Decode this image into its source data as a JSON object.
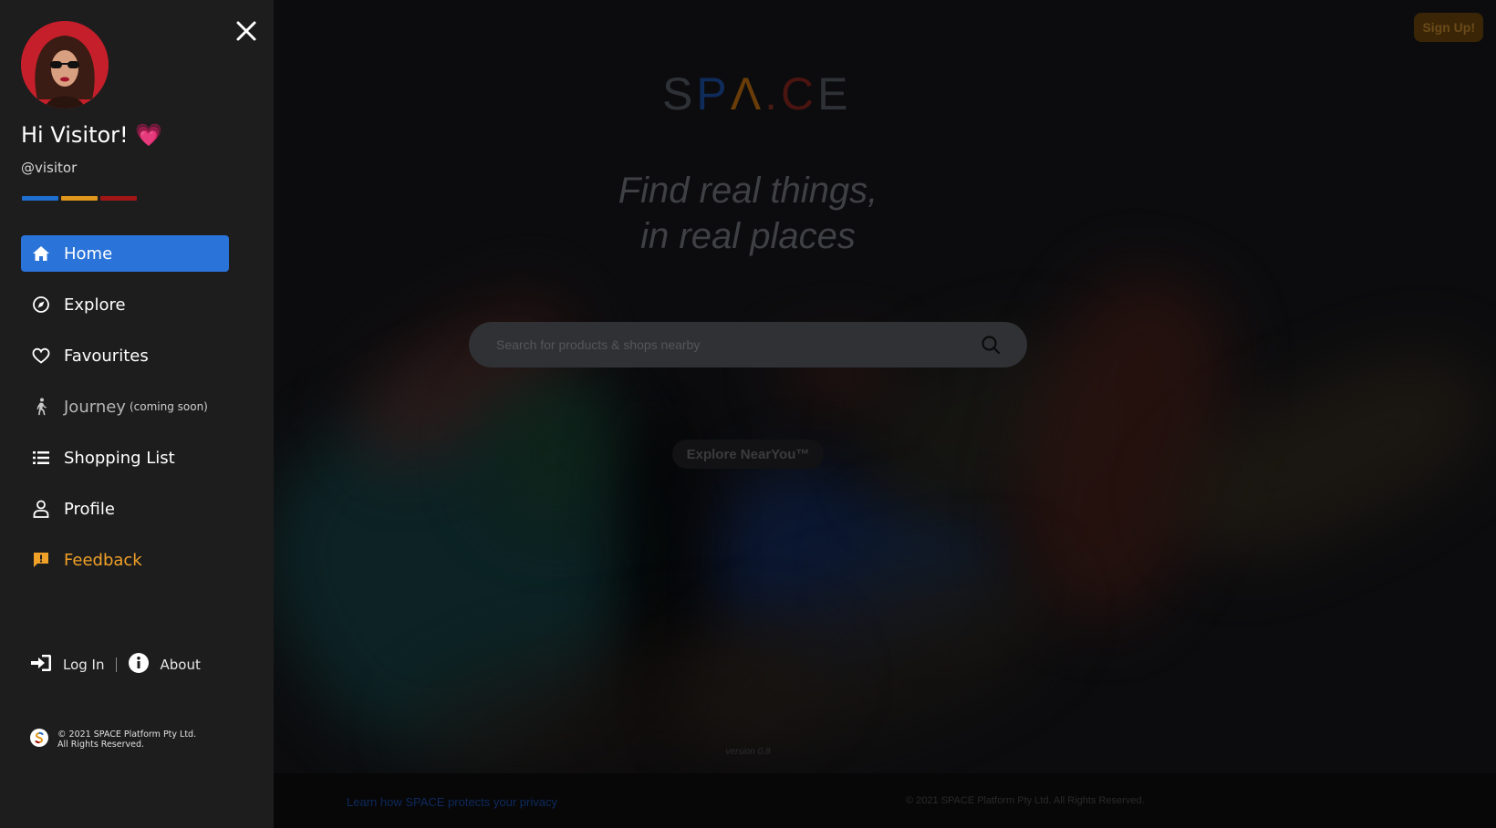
{
  "sidebar": {
    "greeting": "Hi Visitor! 💗",
    "handle": "@visitor",
    "color_bars": [
      "#1f6fd1",
      "#e0961c",
      "#a01616"
    ],
    "menu": [
      {
        "label": "Home",
        "icon": "home-icon"
      },
      {
        "label": "Explore",
        "icon": "compass-icon"
      },
      {
        "label": "Favourites",
        "icon": "heart-icon"
      },
      {
        "label": "Journey",
        "note": "(coming soon)",
        "icon": "walking-person-icon"
      },
      {
        "label": "Shopping List",
        "icon": "list-icon"
      },
      {
        "label": "Profile",
        "icon": "user-icon"
      },
      {
        "label": "Feedback",
        "icon": "feedback-icon"
      }
    ],
    "login_label": "Log In",
    "about_label": "About",
    "copyright_line1": "© 2021 SPACE Platform Pty Ltd.",
    "copyright_line2": "All Rights Reserved."
  },
  "header": {
    "signup_label": "Sign Up!"
  },
  "hero": {
    "logo_letters": [
      "S",
      "P",
      "Λ",
      ".",
      "C",
      "E"
    ],
    "tagline_line1": "Find real things,",
    "tagline_line2": "in real places",
    "search_placeholder": "Search for products & shops nearby",
    "explore_button": "Explore NearYou™",
    "version": "version 0.8"
  },
  "footer": {
    "privacy_link": "Learn how SPACE protects your privacy",
    "copyright": "© 2021 SPACE Platform Pty Ltd. All Rights Reserved."
  },
  "colors": {
    "accent_blue": "#2a73d9",
    "feedback_orange": "#f0a127",
    "sidebar_bg": "#1d1d1e"
  }
}
